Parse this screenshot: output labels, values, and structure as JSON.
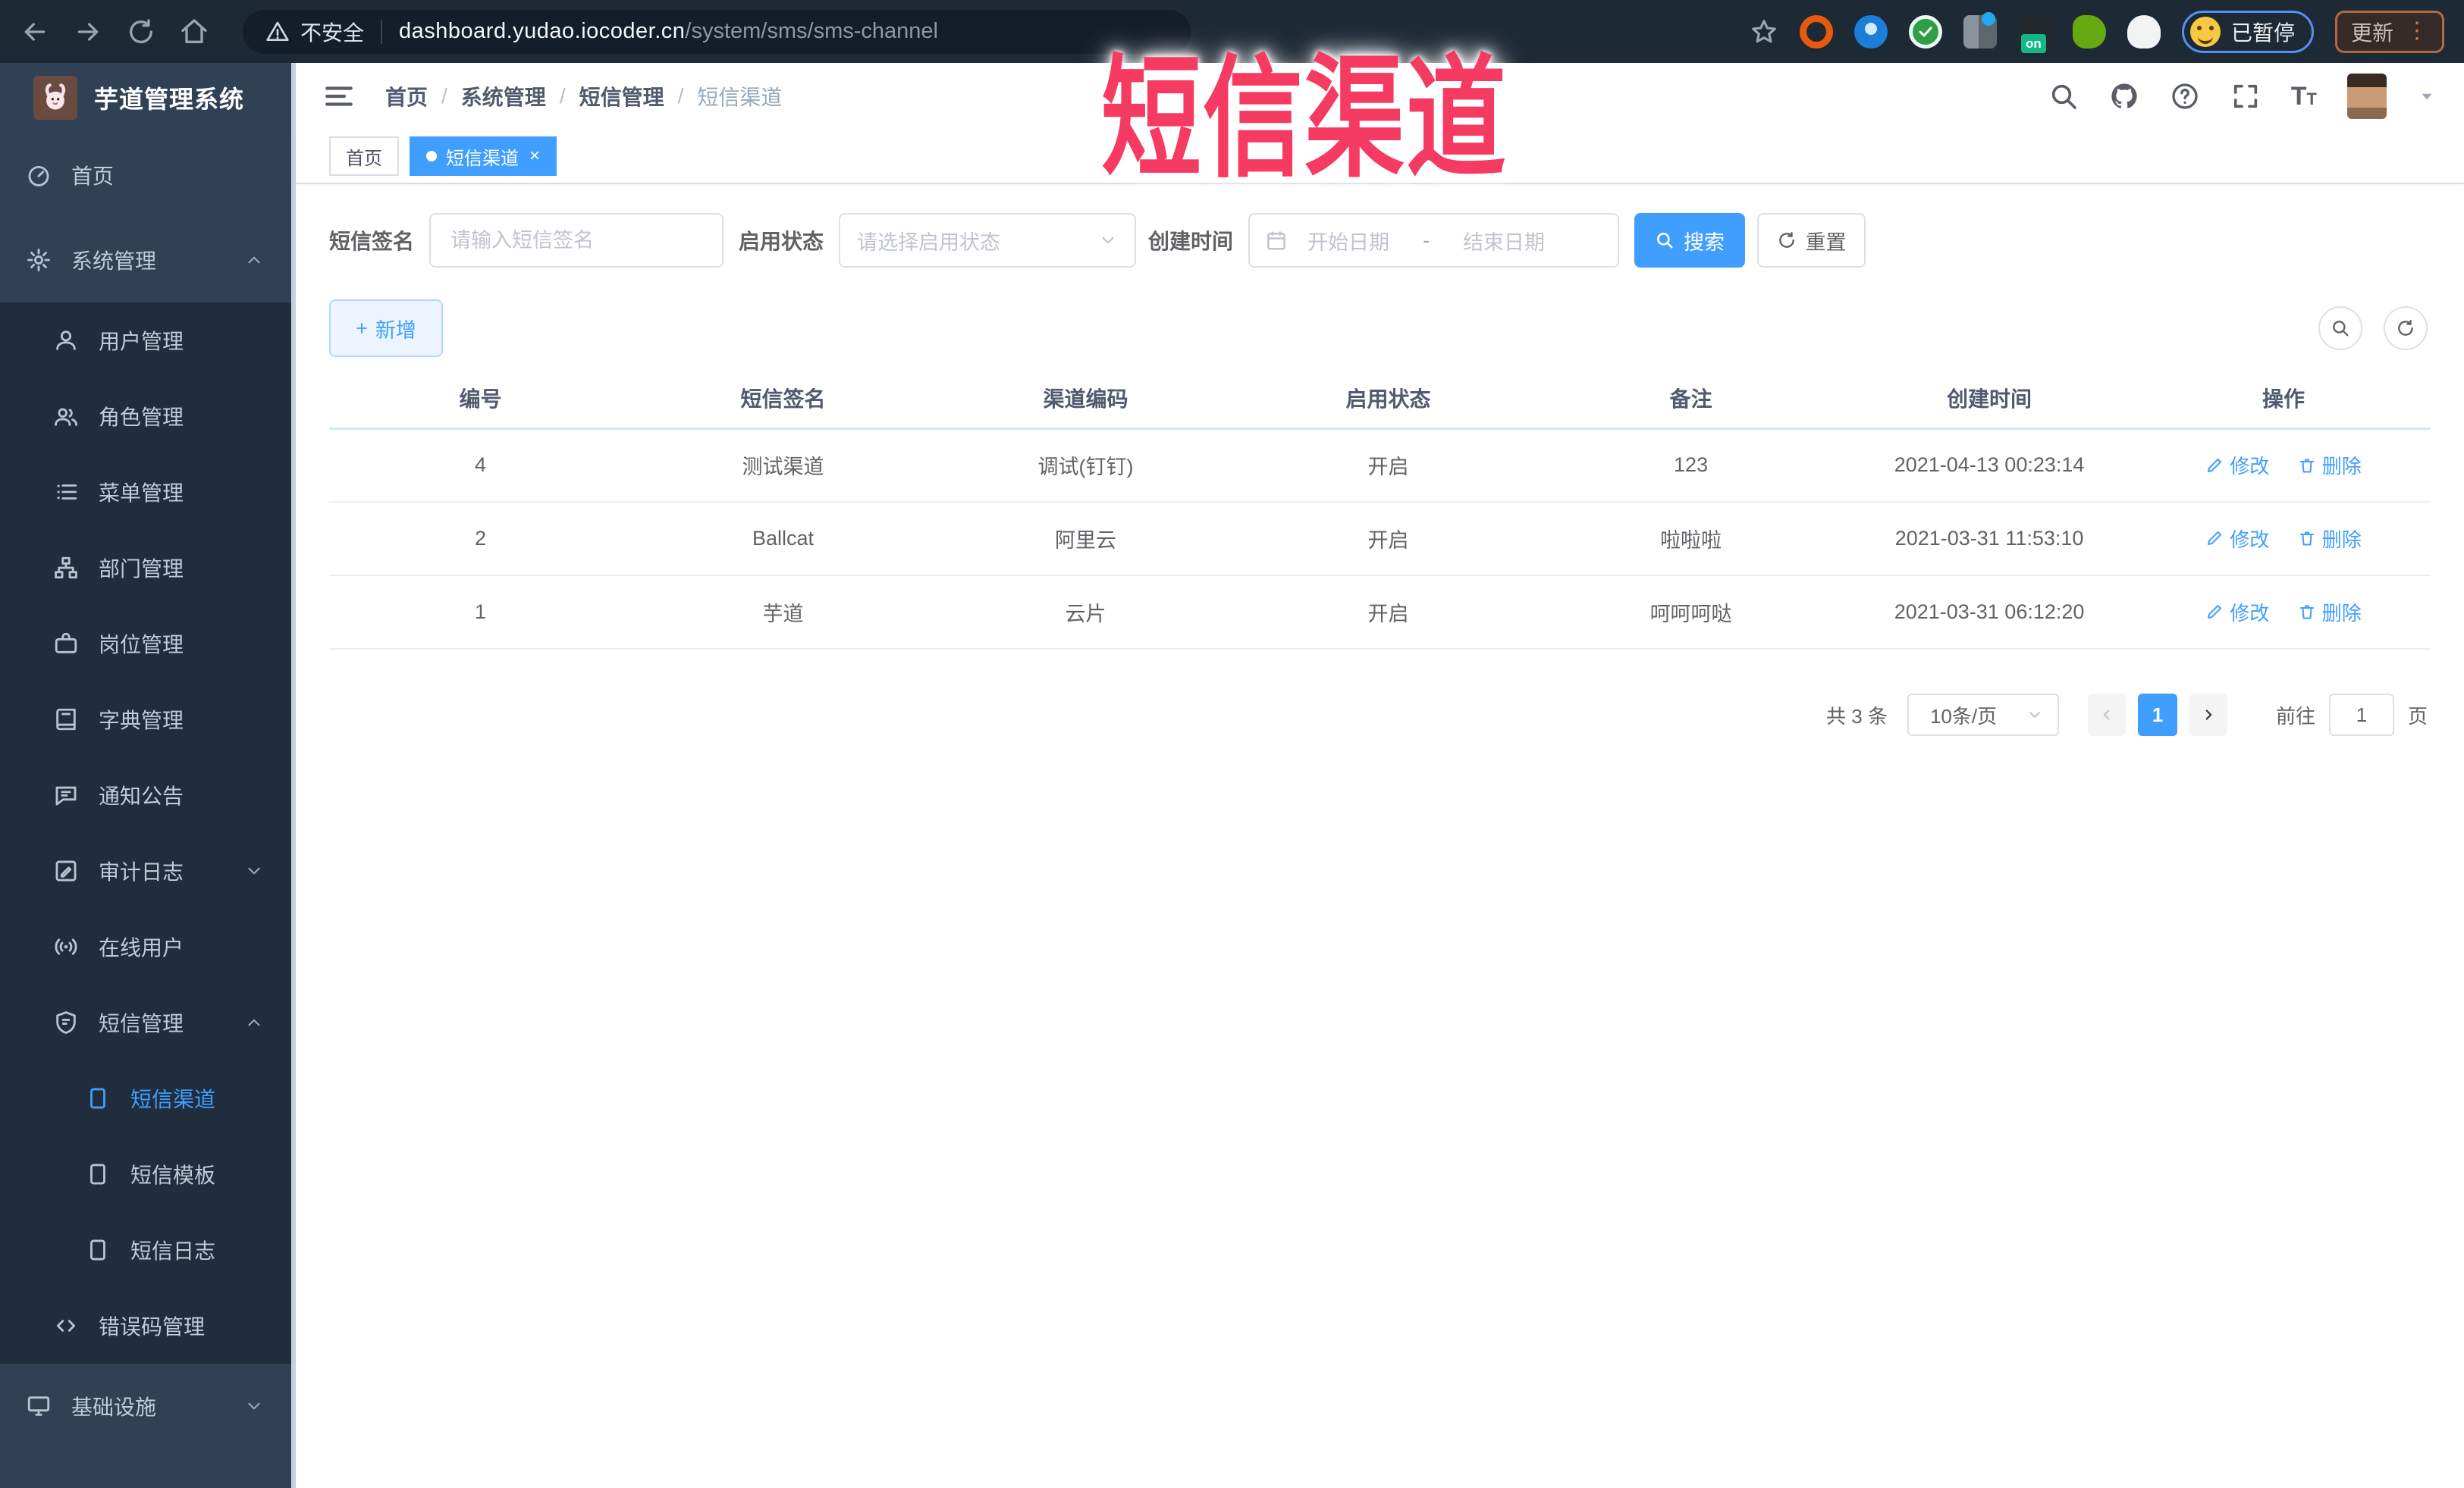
{
  "browser": {
    "security_label": "不安全",
    "url_host": "dashboard.yudao.iocoder.cn",
    "url_path": "/system/sms/sms-channel",
    "ext_on_badge": "on",
    "paused_label": "已暂停",
    "update_label": "更新",
    "update_menu_dots": "⋮"
  },
  "annotation": {
    "text": "短信渠道",
    "color": "#f53b61"
  },
  "sidebar": {
    "title": "芋道管理系统",
    "items": [
      {
        "label": "首页"
      },
      {
        "label": "系统管理"
      },
      {
        "label": "用户管理"
      },
      {
        "label": "角色管理"
      },
      {
        "label": "菜单管理"
      },
      {
        "label": "部门管理"
      },
      {
        "label": "岗位管理"
      },
      {
        "label": "字典管理"
      },
      {
        "label": "通知公告"
      },
      {
        "label": "审计日志"
      },
      {
        "label": "在线用户"
      },
      {
        "label": "短信管理"
      },
      {
        "label": "短信渠道"
      },
      {
        "label": "短信模板"
      },
      {
        "label": "短信日志"
      },
      {
        "label": "错误码管理"
      },
      {
        "label": "基础设施"
      }
    ]
  },
  "navbar": {
    "breadcrumb": [
      "首页",
      "系统管理",
      "短信管理",
      "短信渠道"
    ],
    "separator": "/"
  },
  "tabs": [
    {
      "label": "首页"
    },
    {
      "label": "短信渠道",
      "close": "×"
    }
  ],
  "filters": {
    "sign_label": "短信签名",
    "sign_placeholder": "请输入短信签名",
    "status_label": "启用状态",
    "status_placeholder": "请选择启用状态",
    "date_label": "创建时间",
    "date_start_placeholder": "开始日期",
    "date_separator": "-",
    "date_end_placeholder": "结束日期",
    "search_label": "搜索",
    "reset_label": "重置"
  },
  "toolbar": {
    "add_label": "新增",
    "add_plus": "+"
  },
  "table": {
    "columns": [
      "编号",
      "短信签名",
      "渠道编码",
      "启用状态",
      "备注",
      "创建时间",
      "操作"
    ],
    "edit_label": "修改",
    "delete_label": "删除",
    "rows": [
      {
        "id": "4",
        "sign": "测试渠道",
        "code": "调试(钉钉)",
        "status": "开启",
        "remark": "123",
        "created": "2021-04-13 00:23:14"
      },
      {
        "id": "2",
        "sign": "Ballcat",
        "code": "阿里云",
        "status": "开启",
        "remark": "啦啦啦",
        "created": "2021-03-31 11:53:10"
      },
      {
        "id": "1",
        "sign": "芋道",
        "code": "云片",
        "status": "开启",
        "remark": "呵呵呵哒",
        "created": "2021-03-31 06:12:20"
      }
    ]
  },
  "pagination": {
    "total": "共 3 条",
    "page_size": "10条/页",
    "current_page": "1",
    "goto_label": "前往",
    "goto_value": "1",
    "page_suffix": "页"
  },
  "colors": {
    "accent": "#409eff",
    "sidebar_bg": "#304156",
    "submenu_bg": "#1f2d3d"
  }
}
